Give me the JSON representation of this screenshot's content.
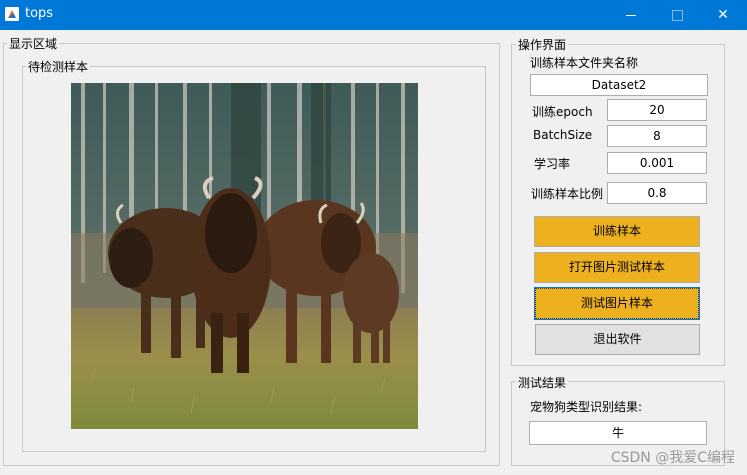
{
  "window": {
    "title": "tops",
    "icon": "matlab-icon"
  },
  "display_panel": {
    "title": "显示区域",
    "subpanel_title": "待检测样本"
  },
  "ops_panel": {
    "title": "操作界面",
    "folder_label": "训练样本文件夹名称",
    "folder_value": "Dataset2",
    "epoch_label": "训练epoch",
    "epoch_value": "20",
    "batch_label": "BatchSize",
    "batch_value": "8",
    "lr_label": "学习率",
    "lr_value": "0.001",
    "ratio_label": "训练样本比例",
    "ratio_value": "0.8",
    "buttons": {
      "train": "训练样本",
      "open_image": "打开图片测试样本",
      "test_image": "测试图片样本",
      "exit": "退出软件"
    }
  },
  "result_panel": {
    "title": "测试结果",
    "label": "宠物狗类型识别结果:",
    "value": "牛"
  },
  "watermark": "CSDN @我爱C编程",
  "colors": {
    "titlebar": "#0078d7",
    "button_accent": "#edb120",
    "background": "#f0f0f0"
  }
}
